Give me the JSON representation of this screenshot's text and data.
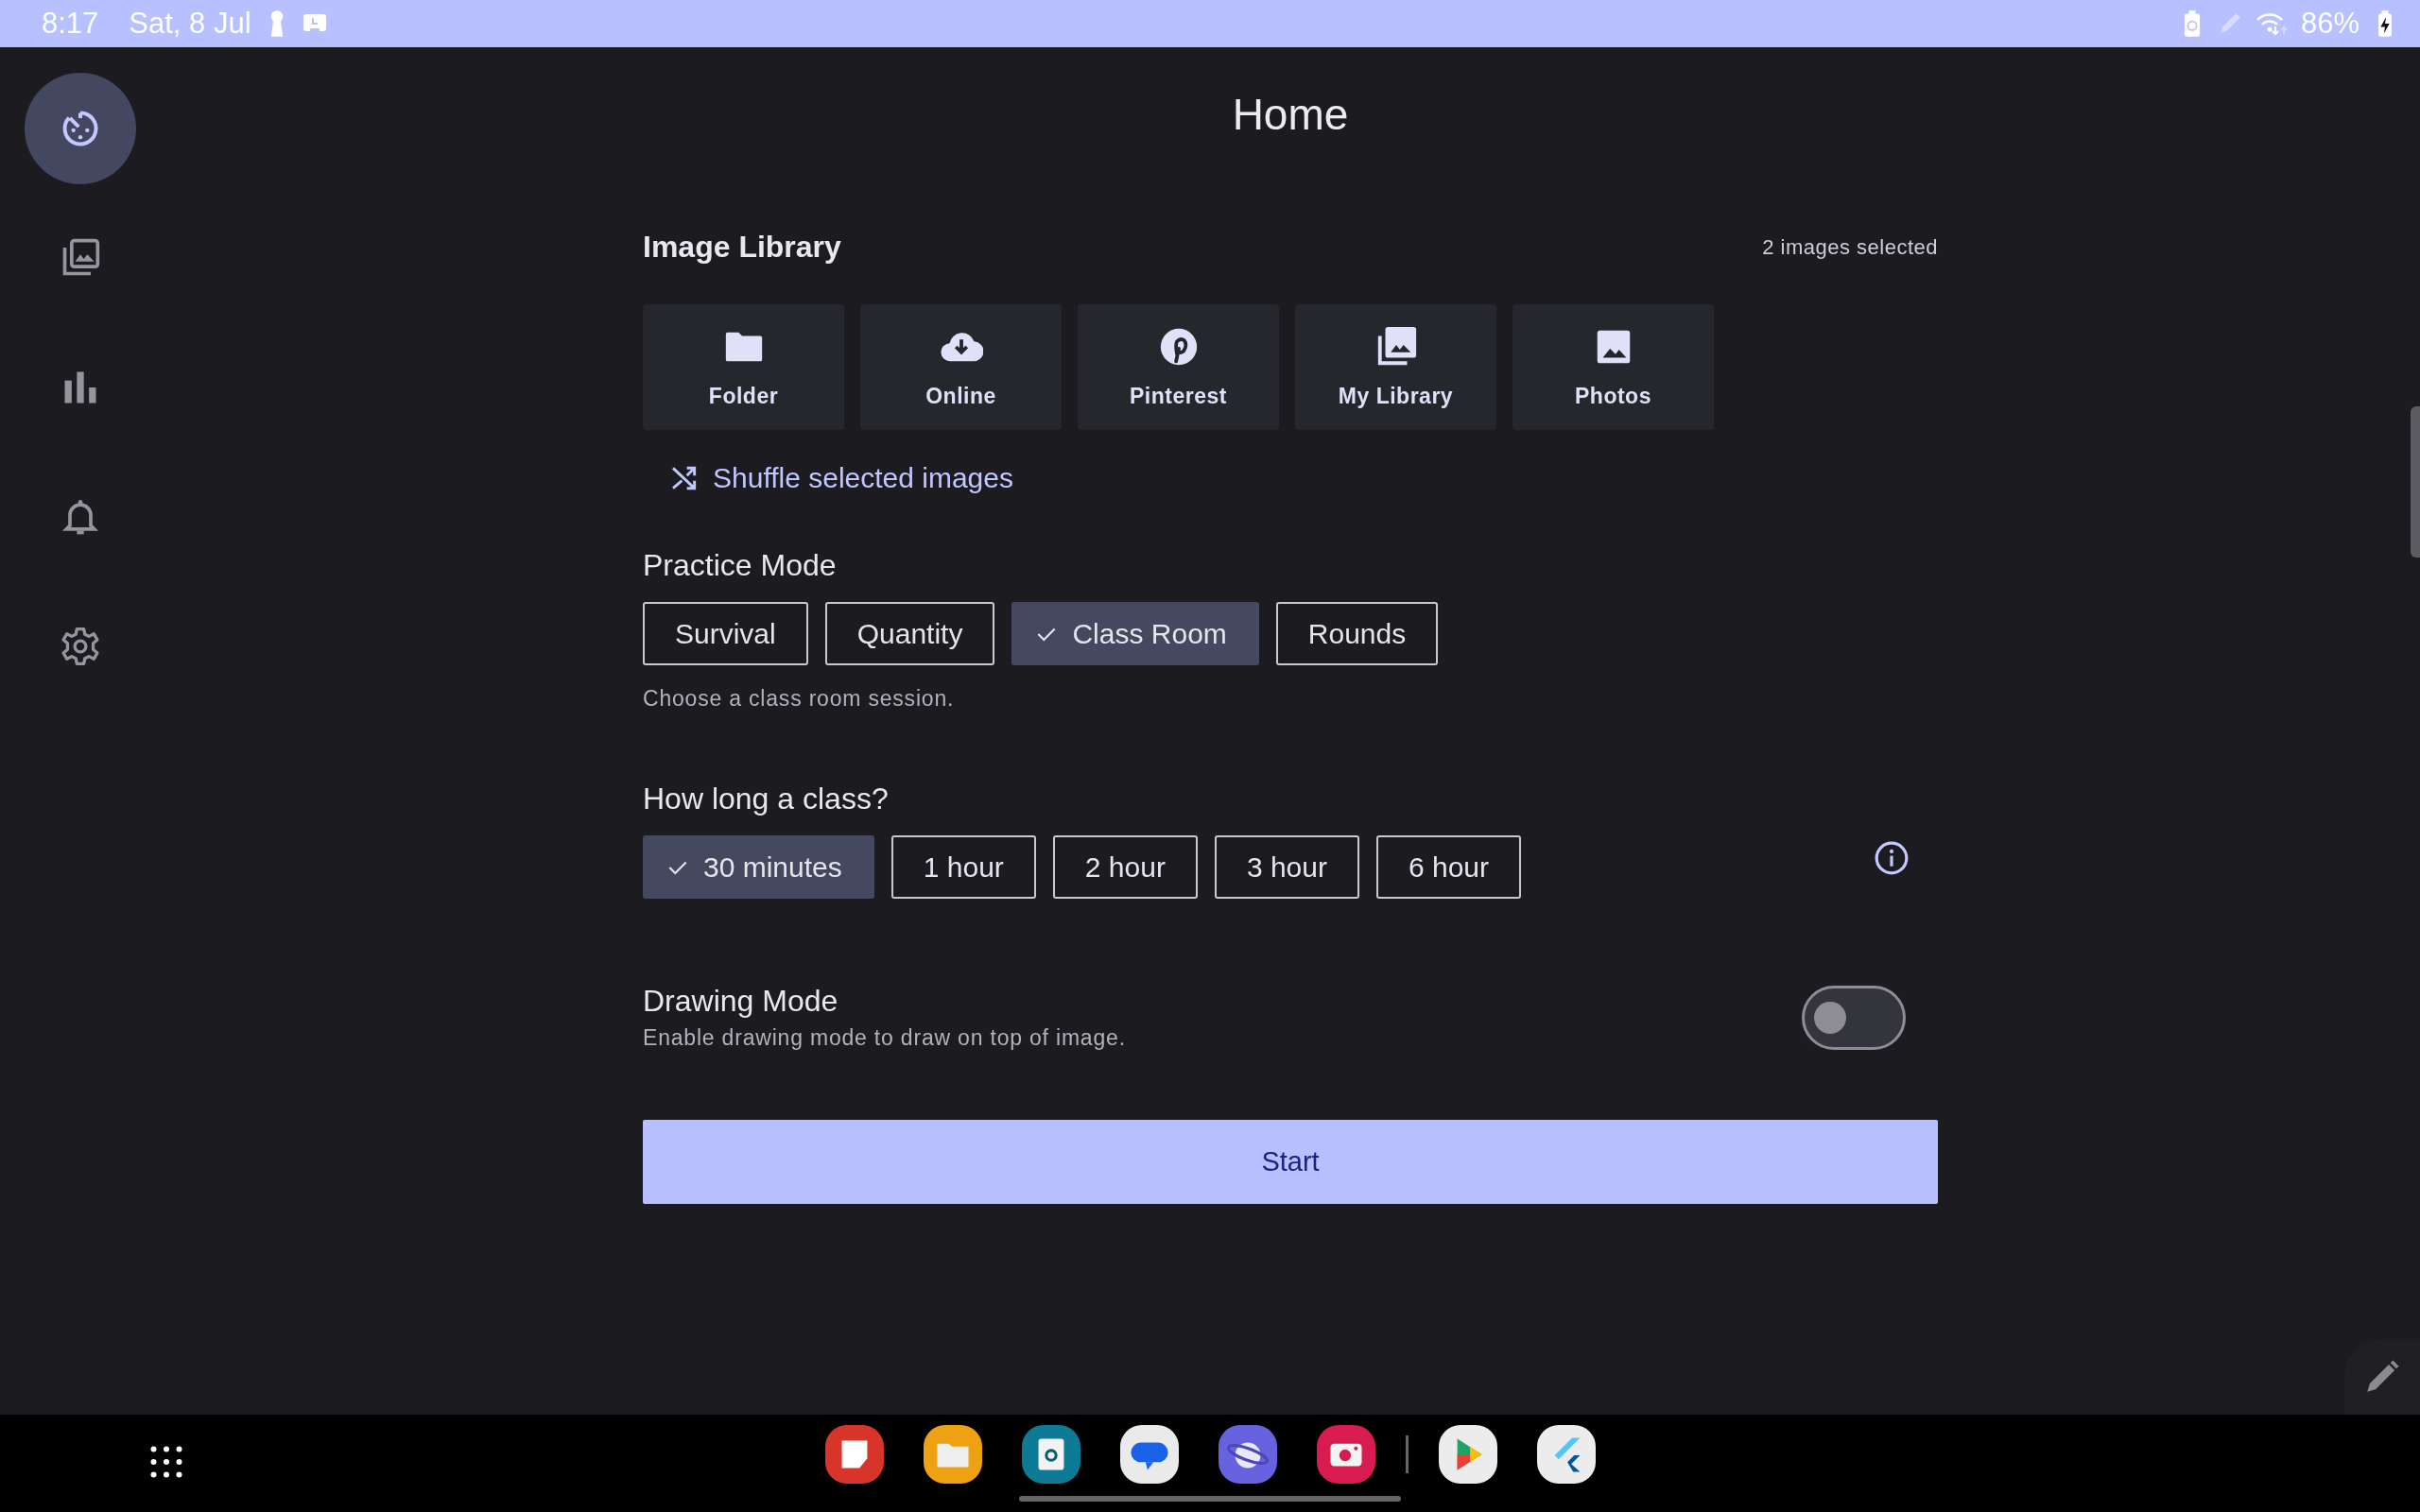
{
  "status_bar": {
    "time": "8:17",
    "date": "Sat, 8 Jul",
    "battery": "86%"
  },
  "sidebar": {
    "items": [
      {
        "kind": "timer",
        "selected": true
      },
      {
        "kind": "library",
        "selected": false
      },
      {
        "kind": "stats",
        "selected": false
      },
      {
        "kind": "notifications",
        "selected": false
      },
      {
        "kind": "settings",
        "selected": false
      }
    ]
  },
  "title": "Home",
  "image_library": {
    "title": "Image Library",
    "count": "2 images selected",
    "sources": [
      {
        "kind": "folder",
        "label": "Folder"
      },
      {
        "kind": "online",
        "label": "Online"
      },
      {
        "kind": "pinterest",
        "label": "Pinterest"
      },
      {
        "kind": "library",
        "label": "My Library"
      },
      {
        "kind": "photos",
        "label": "Photos"
      }
    ],
    "shuffle": "Shuffle selected images"
  },
  "practice_mode": {
    "title": "Practice Mode",
    "options": [
      {
        "label": "Survival",
        "selected": false
      },
      {
        "label": "Quantity",
        "selected": false
      },
      {
        "label": "Class Room",
        "selected": true
      },
      {
        "label": "Rounds",
        "selected": false
      }
    ],
    "helper": "Choose a class room session."
  },
  "class_length": {
    "title": "How long a class?",
    "options": [
      {
        "label": "30 minutes",
        "selected": true
      },
      {
        "label": "1 hour",
        "selected": false
      },
      {
        "label": "2 hour",
        "selected": false
      },
      {
        "label": "3 hour",
        "selected": false
      },
      {
        "label": "6 hour",
        "selected": false
      }
    ]
  },
  "drawing_mode": {
    "title": "Drawing Mode",
    "description": "Enable drawing mode to draw on top of image.",
    "on": false
  },
  "start_button": "Start"
}
